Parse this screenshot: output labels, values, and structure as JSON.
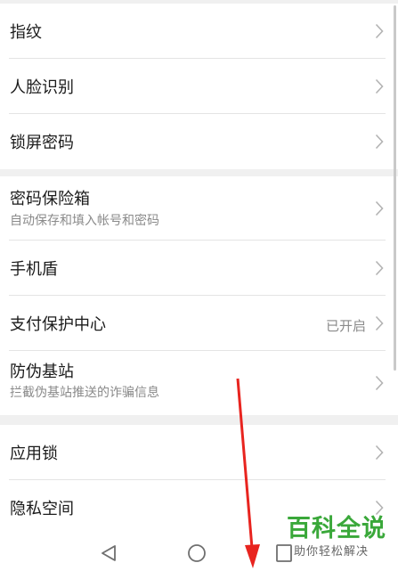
{
  "groups": [
    {
      "items": [
        {
          "title": "指纹"
        },
        {
          "title": "人脸识别"
        },
        {
          "title": "锁屏密码"
        }
      ]
    },
    {
      "items": [
        {
          "title": "密码保险箱",
          "subtitle": "自动保存和填入帐号和密码"
        },
        {
          "title": "手机盾"
        },
        {
          "title": "支付保护中心",
          "value": "已开启"
        },
        {
          "title": "防伪基站",
          "subtitle": "拦截伪基站推送的诈骗信息"
        }
      ]
    },
    {
      "items": [
        {
          "title": "应用锁"
        },
        {
          "title": "隐私空间"
        }
      ]
    }
  ],
  "icons": {
    "row_chevron": "chevron-right-icon",
    "nav_back": "triangle-back-icon",
    "nav_home": "circle-home-icon",
    "nav_recent": "square-recent-icon"
  },
  "annotation": {
    "arrow_color": "#e8241f"
  },
  "watermark": {
    "title": "百科全说",
    "subtitle": "助你轻松解决",
    "color": "#3aa83a"
  }
}
